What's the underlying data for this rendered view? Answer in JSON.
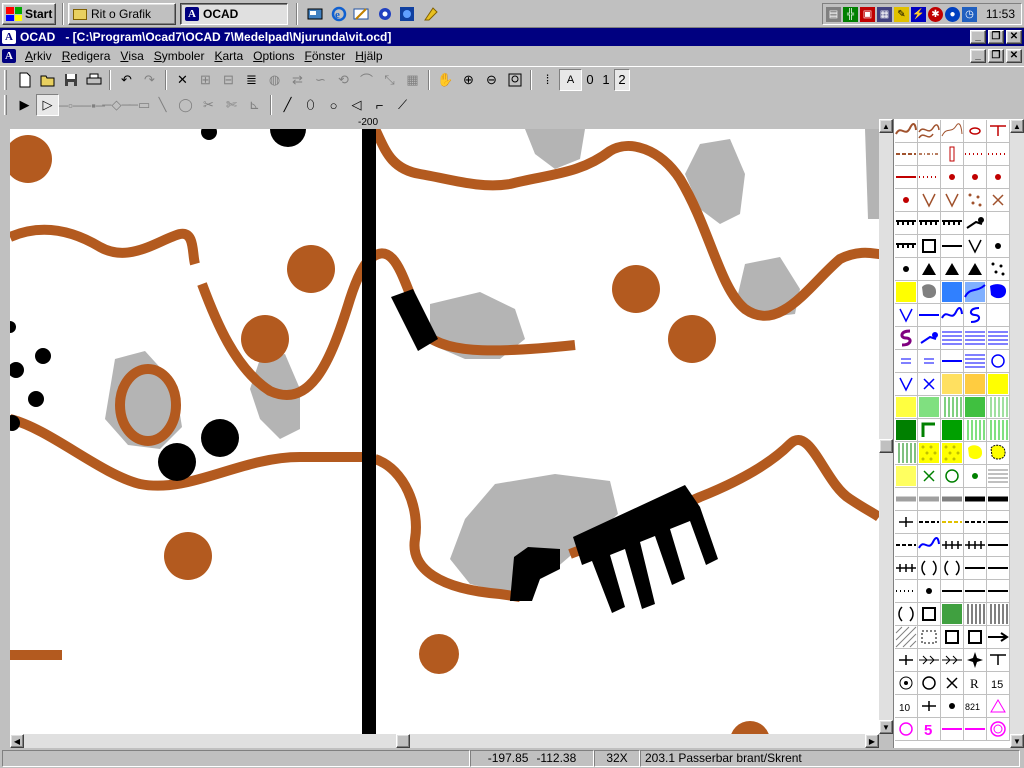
{
  "taskbar": {
    "start_label": "Start",
    "tasks": [
      {
        "label": "Rit o Grafik",
        "icon": "folder-icon",
        "active": false
      },
      {
        "label": "OCAD",
        "icon": "ocad-icon",
        "active": true
      }
    ],
    "quick_launch": [
      "show-desktop-icon",
      "internet-explorer-icon",
      "outlook-express-icon",
      "channels-icon",
      "network-icon",
      "winamp-icon"
    ],
    "tray_icons": [
      "volume-icon",
      "network-tray-icon",
      "display-icon",
      "printer-tray-icon",
      "pen-icon",
      "power-icon",
      "antivirus-icon",
      "messenger-icon",
      "task-scheduler-icon"
    ],
    "clock": "11:53"
  },
  "window": {
    "app_name": "OCAD",
    "title": "- [C:\\Program\\Ocad7\\OCAD 7\\Medelpad\\Njurunda\\vit.ocd]"
  },
  "menu": [
    {
      "label": "Arkiv",
      "accel": "A"
    },
    {
      "label": "Redigera",
      "accel": "R"
    },
    {
      "label": "Visa",
      "accel": "V"
    },
    {
      "label": "Symboler",
      "accel": "S"
    },
    {
      "label": "Karta",
      "accel": "K"
    },
    {
      "label": "Options",
      "accel": "O"
    },
    {
      "label": "Fönster",
      "accel": "F"
    },
    {
      "label": "Hjälp",
      "accel": "H"
    }
  ],
  "toolbar1": {
    "buttons": [
      "new-file-icon",
      "open-file-icon",
      "save-icon",
      "print-icon",
      "undo-icon",
      "redo-icon",
      "cut-icon",
      "split-icon",
      "join-icon",
      "merge-icon",
      "fill-icon",
      "reverse-icon",
      "smooth-icon",
      "rotate-icon",
      "bend-icon",
      "move-icon",
      "grid-icon",
      "pan-icon",
      "zoom-in-icon",
      "zoom-out-icon",
      "zoom-window-icon",
      "snap-icon",
      "text-mode-icon"
    ],
    "view_modes": [
      "0",
      "1",
      "2"
    ],
    "active_view_mode": "2"
  },
  "toolbar2": {
    "buttons": [
      "select-object-icon",
      "edit-point-icon",
      "add-point-icon",
      "delete-point-icon",
      "corner-point-icon",
      "dash-point-icon",
      "straight-line-icon",
      "circle-tool-icon",
      "scissors-icon",
      "cut-hole-icon",
      "measure-icon",
      "freehand-icon",
      "ellipse-icon",
      "circle-icon",
      "rectangle-icon",
      "curve-icon",
      "polyline-icon"
    ]
  },
  "ruler": {
    "label": "-200"
  },
  "colors": {
    "contour": "#b35a1f",
    "rock": "#000000",
    "vegetation_grey": "#b4b4b4",
    "title_bar": "#000080",
    "desktop_grey": "#c0c0c0"
  },
  "status": {
    "coord_x": "-197.85",
    "coord_y": "-112.38",
    "zoom": "32X",
    "symbol": "203.1 Passerbar brant/Skrent"
  },
  "palette": {
    "symbol_count_visible": 100,
    "magenta_number_label": "5",
    "code_label": "821",
    "number_label": "15"
  }
}
